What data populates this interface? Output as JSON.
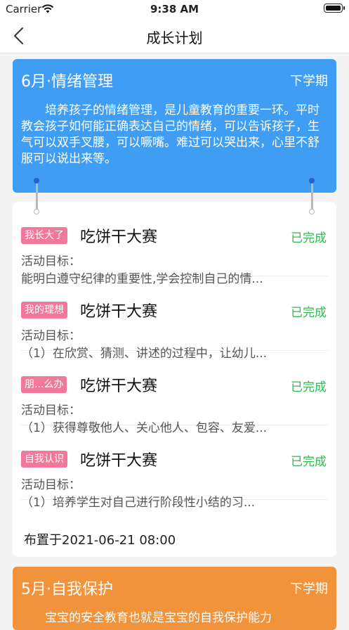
{
  "status_bar": {
    "carrier": "Carrier",
    "time": "9:38 AM"
  },
  "nav": {
    "title": "成长计划",
    "back_icon": "chevron-left-icon"
  },
  "plans": [
    {
      "title": "6月·情绪管理",
      "term": "下学期",
      "description": "培养孩子的情绪管理，是儿童教育的重要一环。平时教会孩子如何能正确表达自己的情绪，可以告诉孩子，生气可以双手叉腰，可以噘嘴。难过可以哭出来，心里不舒服可以说出来等。",
      "color": "#3f9ef4",
      "activities": [
        {
          "tag": "我长大了",
          "name": "吃饼干大赛",
          "status": "已完成",
          "goal_label": "活动目标：",
          "goal": "能明白遵守纪律的重要性,学会控制自己的情..."
        },
        {
          "tag": "我的理想",
          "name": "吃饼干大赛",
          "status": "已完成",
          "goal_label": "活动目标：",
          "goal": "（1）在欣赏、猜测、讲述的过程中，让幼儿..."
        },
        {
          "tag": "朋...么办",
          "name": "吃饼干大赛",
          "status": "已完成",
          "goal_label": "活动目标：",
          "goal": "（1）获得尊敬他人、关心他人、包容、友爱..."
        },
        {
          "tag": "自我认识",
          "name": "吃饼干大赛",
          "status": "已完成",
          "goal_label": "活动目标：",
          "goal": "（1）培养学生对自己进行阶段性小结的习..."
        }
      ],
      "assigned": "布置于2021-06-21 08:00"
    },
    {
      "title": "5月·自我保护",
      "term": "下学期",
      "description": "宝宝的安全教育也就是宝宝的自我保护能力",
      "color": "#f0933a"
    }
  ],
  "colors": {
    "tag": "#f0789a",
    "status_done": "#2fba4e"
  }
}
